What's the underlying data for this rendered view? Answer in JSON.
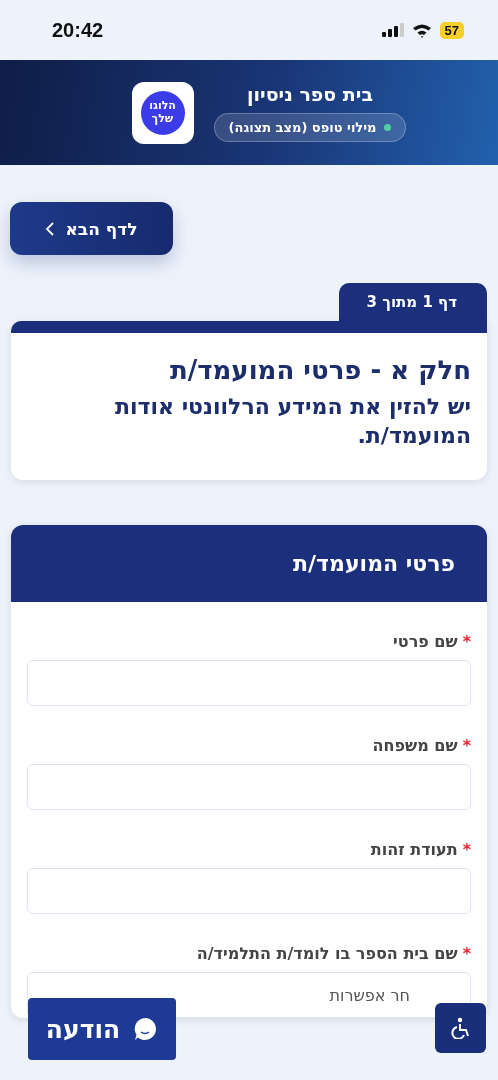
{
  "status_bar": {
    "time": "20:42",
    "battery": "57"
  },
  "header": {
    "title": "בית ספר ניסיון",
    "mode_badge": "מילוי טופס (מצב תצוגה)",
    "logo_text": "הלוגו שלך"
  },
  "next_button": {
    "label": "לדף הבא"
  },
  "page_indicator": "דף 1 מתוך 3",
  "intro_card": {
    "title": "חלק א - פרטי המועמד/ת",
    "subtitle": "יש להזין את המידע הרלוונטי אודות המועמד/ת."
  },
  "form_section": {
    "title": "פרטי המועמד/ת",
    "fields": [
      {
        "kind": "text",
        "label": "שם פרטי",
        "required_mark": "*"
      },
      {
        "kind": "text",
        "label": "שם משפחה",
        "required_mark": "*"
      },
      {
        "kind": "text",
        "label": "תעודת זהות",
        "required_mark": "*"
      },
      {
        "kind": "select",
        "label": "שם בית הספר בו לומד/ת התלמיד/ה",
        "required_mark": "*",
        "placeholder": "חר אפשרות"
      }
    ]
  },
  "notice_button": {
    "label": "הודעה"
  }
}
